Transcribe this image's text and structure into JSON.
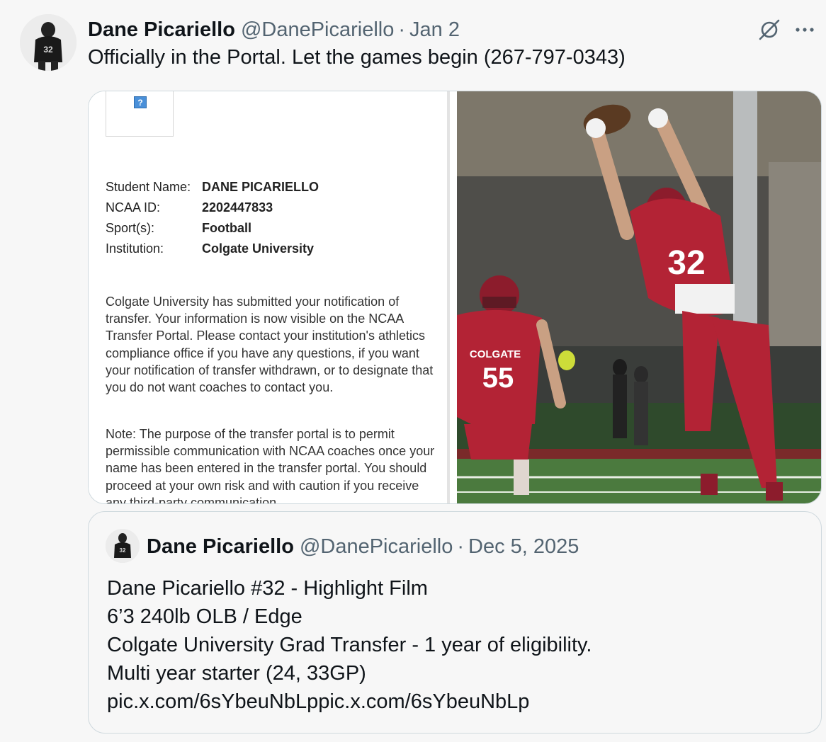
{
  "tweet": {
    "author_name": "Dane Picariello",
    "handle": "@DanePicariello",
    "separator": "·",
    "date": "Jan 2",
    "text": "Officially in the Portal. Let the games begin (267-797-0343)",
    "icons": {
      "avatar": "avatar-photo",
      "grok": "grok-icon",
      "more": "more-icon"
    }
  },
  "media": {
    "left": {
      "logo_placeholder": "?",
      "fields": [
        {
          "label": "Student Name:",
          "value": "DANE PICARIELLO"
        },
        {
          "label": "NCAA ID:",
          "value": "2202447833"
        },
        {
          "label": "Sport(s):",
          "value": "Football"
        },
        {
          "label": "Institution:",
          "value": "Colgate University"
        }
      ],
      "paragraph1": "Colgate University has submitted your notification of transfer. Your information is now visible on the NCAA Transfer Portal. Please contact your institution's athletics compliance office if you have any questions, if you want your notification of transfer withdrawn, or to designate that you do not want coaches to contact you.",
      "paragraph2": "Note: The purpose of the transfer portal is to permit permissible communication with NCAA coaches once your name has been entered in the transfer portal. You should proceed at your own risk and with caution if you receive any third-party communication"
    },
    "right": {
      "jersey_front": "32",
      "jersey_back_team": "COLGATE",
      "jersey_back_number": "55"
    }
  },
  "quote": {
    "author_name": "Dane Picariello",
    "handle": "@DanePicariello",
    "separator": "·",
    "date": "Dec 5, 2025",
    "lines": [
      "Dane Picariello #32 - Highlight Film",
      "6’3 240lb OLB / Edge",
      "Colgate University Grad Transfer - 1 year of eligibility.",
      "Multi year starter (24, 33GP)",
      "pic.x.com/6sYbeuNbLppic.x.com/6sYbeuNbLp"
    ]
  }
}
